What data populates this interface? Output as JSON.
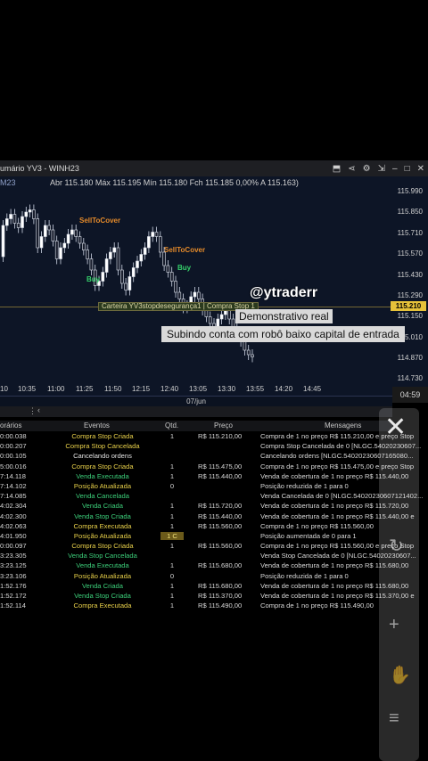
{
  "window": {
    "title": "umário YV3 - WINH23",
    "icons": [
      "export-icon",
      "share-icon",
      "gear-icon",
      "restore-icon",
      "minimize-icon",
      "maximize-icon",
      "close-icon"
    ]
  },
  "chart": {
    "symbol_label": "M23",
    "ohlc_text": "Abr 115.180 Máx 115.195 Mín 115.180 Fch 115.185 0,00% A 115.163)",
    "y_ticks": [
      "115.990",
      "115.850",
      "115.710",
      "115.570",
      "115.430",
      "115.290",
      "115.150",
      "115.010",
      "114.870",
      "114.730"
    ],
    "x_ticks": [
      "10",
      "10:35",
      "11:00",
      "11:25",
      "11:50",
      "12:15",
      "12:40",
      "13:05",
      "13:30",
      "13:55",
      "14:20",
      "14:45"
    ],
    "date_label": "07/jun",
    "last_price": "115.210",
    "clock": "04:59",
    "signals": {
      "sell1": "SellToCover",
      "sell2": "SellToCover",
      "buy1": "Buy",
      "buy2": "Buy"
    },
    "portfolio_label": "Carteira YV3stopdesegurança1 | Compra Stop 1"
  },
  "overlay": {
    "handle": "@ytraderr",
    "demo": "Demonstrativo real",
    "subtitle": "Subindo conta com robô baixo capital de entrada"
  },
  "events": {
    "columns": [
      "orários",
      "Eventos",
      "Qtd.",
      "Preço",
      "Mensagens"
    ],
    "rows": [
      {
        "time": "0:00.038",
        "event": "Compra Stop Criada",
        "color": "yellow",
        "qty": "1",
        "price": "R$ 115.210,00",
        "msg": "Compra de 1 no preço R$ 115.210,00 e preço Stop"
      },
      {
        "time": "0:00.207",
        "event": "Compra Stop Cancelada",
        "color": "yellow",
        "qty": "",
        "price": "",
        "msg": "Compra Stop Cancelada de 0 [NLGC.54020230607..."
      },
      {
        "time": "0:00.105",
        "event": "Cancelando ordens",
        "color": "white",
        "qty": "",
        "price": "",
        "msg": "Cancelando ordens [NLGC.54020230607165080..."
      },
      {
        "time": "5:00.016",
        "event": "Compra Stop Criada",
        "color": "yellow",
        "qty": "1",
        "price": "R$ 115.475,00",
        "msg": "Compra de 1 no preço R$ 115.475,00 e preço Stop"
      },
      {
        "time": "7:14.118",
        "event": "Venda Executada",
        "color": "green",
        "qty": "1",
        "price": "R$ 115.440,00",
        "msg": "Venda de cobertura de 1 no preço R$ 115.440,00"
      },
      {
        "time": "7:14.102",
        "event": "Posição Atualizada",
        "color": "yellow",
        "qty": "0",
        "price": "",
        "msg": "Posição reduzida de 1 para 0"
      },
      {
        "time": "7:14.085",
        "event": "Venda Cancelada",
        "color": "green",
        "qty": "",
        "price": "",
        "msg": "Venda Cancelada de 0 [NLGC.54020230607121402..."
      },
      {
        "time": "4:02.304",
        "event": "Venda Criada",
        "color": "green",
        "qty": "1",
        "price": "R$ 115.720,00",
        "msg": "Venda de cobertura de 1 no preço R$ 115.720,00"
      },
      {
        "time": "4:02.300",
        "event": "Venda Stop Criada",
        "color": "green",
        "qty": "1",
        "price": "R$ 115.440,00",
        "msg": "Venda de cobertura de 1 no preço R$ 115.440,00 e"
      },
      {
        "time": "4:02.063",
        "event": "Compra Executada",
        "color": "yellow",
        "qty": "1",
        "price": "R$ 115.560,00",
        "msg": "Compra de 1 no preço R$ 115.560,00"
      },
      {
        "time": "4:01.950",
        "event": "Posição Atualizada",
        "color": "yellow",
        "qty": "1 C",
        "price": "",
        "msg": "Posição aumentada de 0 para 1"
      },
      {
        "time": "0:00.097",
        "event": "Compra Stop Criada",
        "color": "yellow",
        "qty": "1",
        "price": "R$ 115.560,00",
        "msg": "Compra de 1 no preço R$ 115.560,00 e preço Stop"
      },
      {
        "time": "3:23.305",
        "event": "Venda Stop Cancelada",
        "color": "green",
        "qty": "",
        "price": "",
        "msg": "Venda Stop Cancelada de 0 [NLGC.54020230607..."
      },
      {
        "time": "3:23.125",
        "event": "Venda Executada",
        "color": "green",
        "qty": "1",
        "price": "R$ 115.680,00",
        "msg": "Venda de cobertura de 1 no preço R$ 115.680,00"
      },
      {
        "time": "3:23.106",
        "event": "Posição Atualizada",
        "color": "yellow",
        "qty": "0",
        "price": "",
        "msg": "Posição reduzida de 1 para 0"
      },
      {
        "time": "1:52.176",
        "event": "Venda Criada",
        "color": "green",
        "qty": "1",
        "price": "R$ 115.680,00",
        "msg": "Venda de cobertura de 1 no preço R$ 115.680,00"
      },
      {
        "time": "1:52.172",
        "event": "Venda Stop Criada",
        "color": "green",
        "qty": "1",
        "price": "R$ 115.370,00",
        "msg": "Venda de cobertura de 1 no preço R$ 115.370,00 e"
      },
      {
        "time": "1:52.114",
        "event": "Compra Executada",
        "color": "yellow",
        "qty": "1",
        "price": "R$ 115.490,00",
        "msg": "Compra de 1 no preço R$ 115.490,00"
      }
    ]
  },
  "colors": {
    "chart_bg": "#0d1526",
    "event_yellow": "#e8d04a",
    "event_green": "#3ccf7a",
    "price_tag": "#e6c23a"
  }
}
